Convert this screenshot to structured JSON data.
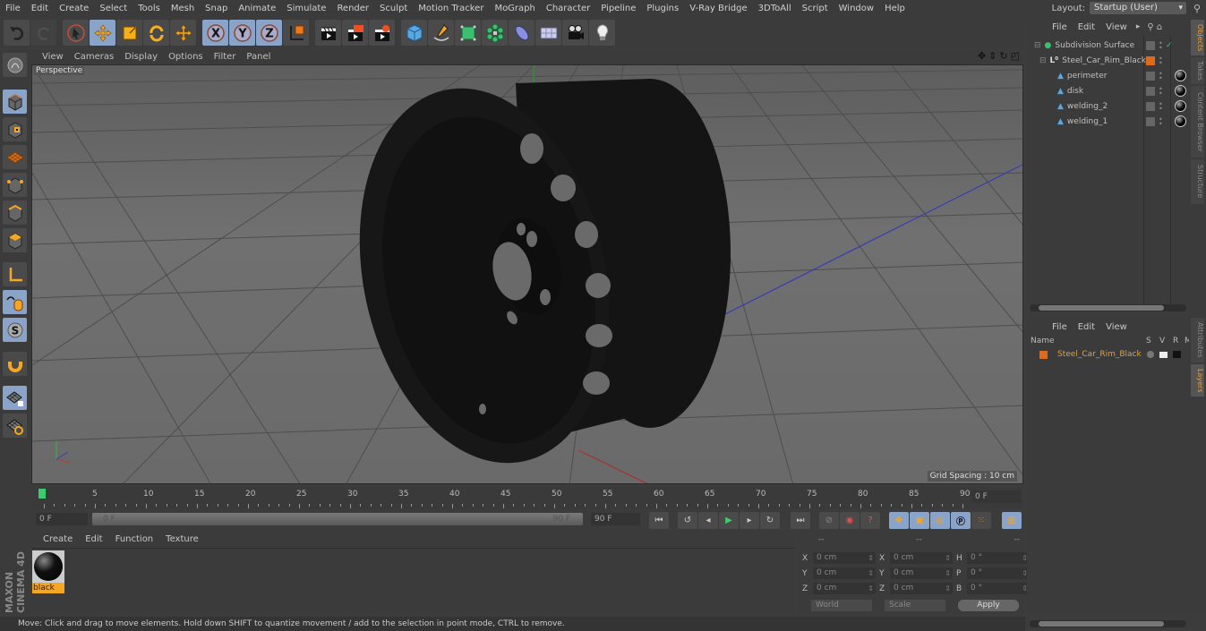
{
  "menubar": {
    "items": [
      "File",
      "Edit",
      "Create",
      "Select",
      "Tools",
      "Mesh",
      "Snap",
      "Animate",
      "Simulate",
      "Render",
      "Sculpt",
      "Motion Tracker",
      "MoGraph",
      "Character",
      "Pipeline",
      "Plugins",
      "V-Ray Bridge",
      "3DToAll",
      "Script",
      "Window",
      "Help"
    ],
    "layout_label": "Layout:",
    "layout_value": "Startup (User)"
  },
  "toolbar": {
    "icons": [
      "undo-icon",
      "redo-icon",
      "live-selection-icon",
      "move-icon",
      "scale-icon",
      "rotate-icon",
      "recent-tool-icon",
      "x-axis-icon",
      "y-axis-icon",
      "z-axis-icon",
      "coordinate-system-icon",
      "render-view-icon",
      "render-picture-viewer-icon",
      "render-settings-icon",
      "cube-icon",
      "pen-spline-icon",
      "subdivision-surface-icon",
      "cloner-icon",
      "deformer-icon",
      "floor-icon",
      "camera-icon",
      "light-icon"
    ]
  },
  "left_tools": {
    "icons": [
      "make-editable-icon",
      "model-mode-icon",
      "texture-mode-icon",
      "workplane-mode-icon",
      "points-mode-icon",
      "edges-mode-icon",
      "polygons-mode-icon",
      "axis-mode-icon",
      "tweak-mode-icon",
      "solo-mode-icon",
      "snapping-icon",
      "workplane-lock-icon",
      "workplane-align-icon"
    ]
  },
  "viewport": {
    "menu": [
      "View",
      "Cameras",
      "Display",
      "Options",
      "Filter",
      "Panel"
    ],
    "label": "Perspective",
    "grid_spacing": "Grid Spacing : 10 cm",
    "object": "Steel_Car_Rim_Black"
  },
  "timeline": {
    "ticks": [
      "0",
      "5",
      "10",
      "15",
      "20",
      "25",
      "30",
      "35",
      "40",
      "45",
      "50",
      "55",
      "60",
      "65",
      "70",
      "75",
      "80",
      "85",
      "90"
    ],
    "current_frame": "0 F",
    "start_field": "0 F",
    "range_start": "0 F",
    "range_end": "90 F",
    "end_field": "90 F"
  },
  "material_manager": {
    "menu": [
      "Create",
      "Edit",
      "Function",
      "Texture"
    ],
    "materials": [
      {
        "name": "black"
      }
    ]
  },
  "coordinates": {
    "headers": [
      "--",
      "--",
      "--"
    ],
    "rows": [
      {
        "l1": "X",
        "v1": "0 cm",
        "l2": "X",
        "v2": "0 cm",
        "l3": "H",
        "v3": "0 °"
      },
      {
        "l1": "Y",
        "v1": "0 cm",
        "l2": "Y",
        "v2": "0 cm",
        "l3": "P",
        "v3": "0 °"
      },
      {
        "l1": "Z",
        "v1": "0 cm",
        "l2": "Z",
        "v2": "0 cm",
        "l3": "B",
        "v3": "0 °"
      }
    ],
    "mode": "World",
    "transform": "Scale",
    "apply_label": "Apply"
  },
  "status": "Move: Click and drag to move elements. Hold down SHIFT to quantize movement / add to the selection in point mode, CTRL to remove.",
  "object_manager": {
    "menu": [
      "File",
      "Edit",
      "View"
    ],
    "objects": [
      {
        "name": "Subdivision Surface",
        "level": 0,
        "icon": "subdivision-surface-icon"
      },
      {
        "name": "Steel_Car_Rim_Black",
        "level": 1,
        "icon": "null-object-icon"
      },
      {
        "name": "perimeter",
        "level": 2,
        "icon": "polygon-object-icon"
      },
      {
        "name": "disk",
        "level": 2,
        "icon": "polygon-object-icon"
      },
      {
        "name": "welding_2",
        "level": 2,
        "icon": "polygon-object-icon"
      },
      {
        "name": "welding_1",
        "level": 2,
        "icon": "polygon-object-icon"
      }
    ]
  },
  "layer_manager": {
    "menu": [
      "File",
      "Edit",
      "View"
    ],
    "columns": {
      "name": "Name",
      "s": "S",
      "v": "V",
      "r": "R",
      "m": "M"
    },
    "layers": [
      {
        "name": "Steel_Car_Rim_Black",
        "color": "#e06a1a"
      }
    ]
  },
  "side_tabs": {
    "top": [
      "Objects",
      "Takes",
      "Content Browser",
      "Structure"
    ],
    "bottom": [
      "Attributes",
      "Layers"
    ]
  },
  "branding": "MAXON CINEMA 4D",
  "colors": {
    "accent": "#8aa3c8",
    "orange": "#e06a1a",
    "layer_text": "#e0a040"
  }
}
